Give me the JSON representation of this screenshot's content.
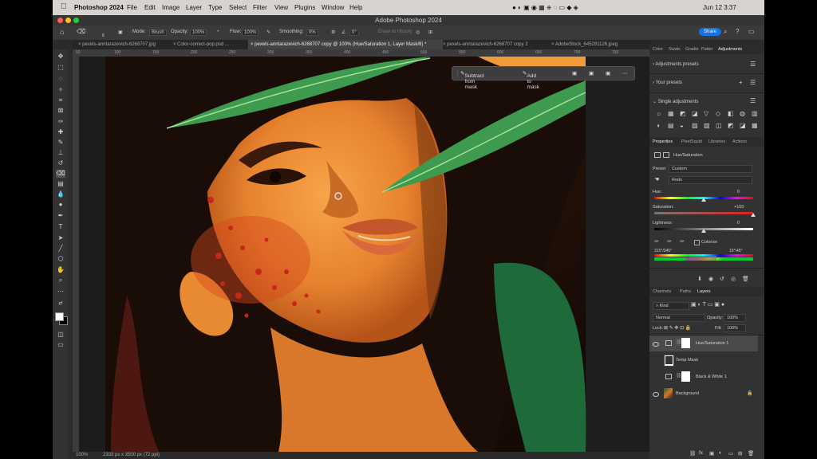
{
  "menubar": {
    "app_name": "Photoshop 2024",
    "items": [
      "File",
      "Edit",
      "Image",
      "Layer",
      "Type",
      "Select",
      "Filter",
      "View",
      "Plugins",
      "Window",
      "Help"
    ],
    "clock": "Jun 12  3:37"
  },
  "window": {
    "title": "Adobe Photoshop 2024"
  },
  "options_bar": {
    "mode_label": "Mode:",
    "mode_value": "Brush",
    "opacity_label": "Opacity:",
    "opacity_value": "100%",
    "flow_label": "Flow:",
    "flow_value": "100%",
    "smoothing_label": "Smoothing:",
    "smoothing_value": "0%",
    "angle_value": "0°",
    "brush_size": "8",
    "erase_history": "Erase to History",
    "share_label": "Share"
  },
  "tabs": [
    {
      "label": "pexels-anntarazevich-6268707.jpg",
      "active": false
    },
    {
      "label": "Color-correct-pop.psd ...",
      "active": false
    },
    {
      "label": "pexels-anntarazevich-6268707 copy @ 100% (Hue/Saturation 1, Layer Mask/8) *",
      "active": true
    },
    {
      "label": "pexels-anntarazevich-6268707 copy 2",
      "active": false
    },
    {
      "label": "AdobeStock_645281126.jpeg",
      "active": false
    }
  ],
  "ruler_ticks": [
    "50",
    "100",
    "150",
    "200",
    "250",
    "300",
    "350",
    "400",
    "450",
    "500",
    "550",
    "600",
    "650",
    "700",
    "750"
  ],
  "context_bar": {
    "subtract": "Subtract from mask",
    "add": "Add to mask"
  },
  "status": {
    "zoom": "100%",
    "doc_size": "2333 px x 3500 px (72 ppi)"
  },
  "panel_tabs_top": [
    "Color",
    "Swatc",
    "Gradie",
    "Patter",
    "Adjustments"
  ],
  "adjustments": {
    "presets": "Adjustments presets",
    "your_presets": "Your presets",
    "single": "Single adjustments"
  },
  "panel_tabs_mid": [
    "Properties",
    "PixelSquid",
    "Libraries",
    "Actions"
  ],
  "properties": {
    "title": "Hue/Saturation",
    "preset_label": "Preset:",
    "preset_value": "Custom",
    "channel_value": "Reds",
    "hue_label": "Hue:",
    "hue_value": "0",
    "sat_label": "Saturation:",
    "sat_value": "+100",
    "light_label": "Lightness:",
    "light_value": "0",
    "colorize_label": "Colorize",
    "range_left": "315°/345°",
    "range_right": "15°\\45°",
    "hue": 0,
    "saturation": 100,
    "lightness": 0
  },
  "panel_tabs_layers": [
    "Channels",
    "Paths",
    "Layers"
  ],
  "layers_panel": {
    "kind_value": "Kind",
    "blend_value": "Normal",
    "opacity_label": "Opacity:",
    "opacity_value": "100%",
    "lock_label": "Lock:",
    "fill_label": "Fill:",
    "fill_value": "100%",
    "layers": [
      {
        "name": "Hue/Saturation 1",
        "selected": true
      },
      {
        "name": "Temp Mask",
        "selected": false
      },
      {
        "name": "Black & White 1",
        "selected": false
      },
      {
        "name": "Background",
        "selected": false
      }
    ]
  },
  "colors": {
    "accent": "#1473e6",
    "bg": "#2b2b2b",
    "panel": "#323232"
  }
}
